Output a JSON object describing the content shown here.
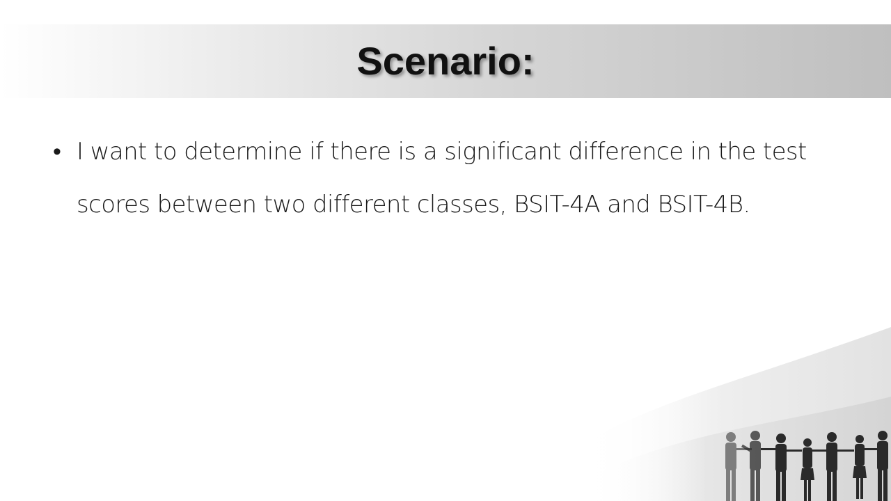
{
  "slide": {
    "title": "Scenario:",
    "bullets": [
      "I want to determine if there is a significant difference in the test scores between two different classes, BSIT-4A and BSIT-4B."
    ],
    "colors": {
      "background": "#ffffff",
      "title_band_start": "#ffffff",
      "title_band_end": "#bfbfbf",
      "text": "#1a1a1a"
    },
    "decoration": "people-silhouettes-wave-image"
  }
}
